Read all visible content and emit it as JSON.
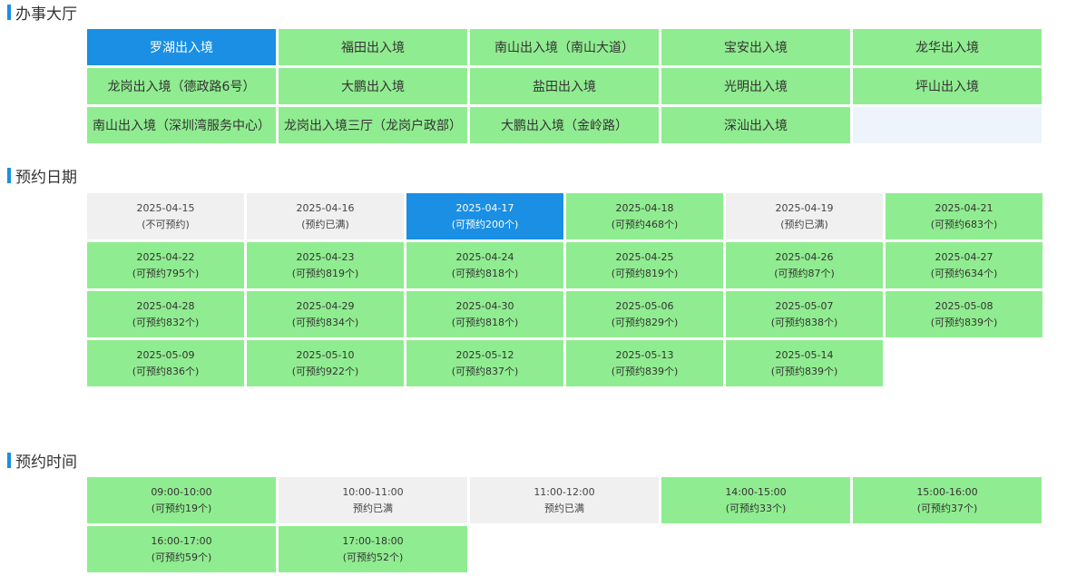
{
  "sections": {
    "hall_title": "办事大厅",
    "date_title": "预约日期",
    "time_title": "预约时间"
  },
  "halls": [
    {
      "name": "罗湖出入境",
      "state": "selected"
    },
    {
      "name": "福田出入境",
      "state": "available"
    },
    {
      "name": "南山出入境（南山大道）",
      "state": "available"
    },
    {
      "name": "宝安出入境",
      "state": "available"
    },
    {
      "name": "龙华出入境",
      "state": "available"
    },
    {
      "name": "龙岗出入境（德政路6号）",
      "state": "available"
    },
    {
      "name": "大鹏出入境",
      "state": "available"
    },
    {
      "name": "盐田出入境",
      "state": "available"
    },
    {
      "name": "光明出入境",
      "state": "available"
    },
    {
      "name": "坪山出入境",
      "state": "available"
    },
    {
      "name": "南山出入境（深圳湾服务中心）",
      "state": "available"
    },
    {
      "name": "龙岗出入境三厅（龙岗户政部）",
      "state": "available"
    },
    {
      "name": "大鹏出入境（金岭路）",
      "state": "available"
    },
    {
      "name": "深汕出入境",
      "state": "available"
    }
  ],
  "dates": [
    {
      "date": "2025-04-15",
      "status": "(不可预约)",
      "state": "disabled"
    },
    {
      "date": "2025-04-16",
      "status": "(预约已满)",
      "state": "disabled"
    },
    {
      "date": "2025-04-17",
      "status": "(可预约200个)",
      "state": "selected"
    },
    {
      "date": "2025-04-18",
      "status": "(可预约468个)",
      "state": "available"
    },
    {
      "date": "2025-04-19",
      "status": "(预约已满)",
      "state": "disabled"
    },
    {
      "date": "2025-04-21",
      "status": "(可预约683个)",
      "state": "available"
    },
    {
      "date": "2025-04-22",
      "status": "(可预约795个)",
      "state": "available"
    },
    {
      "date": "2025-04-23",
      "status": "(可预约819个)",
      "state": "available"
    },
    {
      "date": "2025-04-24",
      "status": "(可预约818个)",
      "state": "available"
    },
    {
      "date": "2025-04-25",
      "status": "(可预约819个)",
      "state": "available"
    },
    {
      "date": "2025-04-26",
      "status": "(可预约87个)",
      "state": "available"
    },
    {
      "date": "2025-04-27",
      "status": "(可预约634个)",
      "state": "available"
    },
    {
      "date": "2025-04-28",
      "status": "(可预约832个)",
      "state": "available"
    },
    {
      "date": "2025-04-29",
      "status": "(可预约834个)",
      "state": "available"
    },
    {
      "date": "2025-04-30",
      "status": "(可预约818个)",
      "state": "available"
    },
    {
      "date": "2025-05-06",
      "status": "(可预约829个)",
      "state": "available"
    },
    {
      "date": "2025-05-07",
      "status": "(可预约838个)",
      "state": "available"
    },
    {
      "date": "2025-05-08",
      "status": "(可预约839个)",
      "state": "available"
    },
    {
      "date": "2025-05-09",
      "status": "(可预约836个)",
      "state": "available"
    },
    {
      "date": "2025-05-10",
      "status": "(可预约922个)",
      "state": "available"
    },
    {
      "date": "2025-05-12",
      "status": "(可预约837个)",
      "state": "available"
    },
    {
      "date": "2025-05-13",
      "status": "(可预约839个)",
      "state": "available"
    },
    {
      "date": "2025-05-14",
      "status": "(可预约839个)",
      "state": "available"
    }
  ],
  "times": [
    {
      "time": "09:00-10:00",
      "status": "(可预约19个)",
      "state": "available"
    },
    {
      "time": "10:00-11:00",
      "status": "预约已满",
      "state": "disabled"
    },
    {
      "time": "11:00-12:00",
      "status": "预约已满",
      "state": "disabled"
    },
    {
      "time": "14:00-15:00",
      "status": "(可预约33个)",
      "state": "available"
    },
    {
      "time": "15:00-16:00",
      "status": "(可预约37个)",
      "state": "available"
    },
    {
      "time": "16:00-17:00",
      "status": "(可预约59个)",
      "state": "available"
    },
    {
      "time": "17:00-18:00",
      "status": "(可预约52个)",
      "state": "available"
    }
  ],
  "colors": {
    "available": "#90ec90",
    "selected": "#1a8fe3",
    "disabled": "#f0f0f0",
    "accent_bar": "#1a8fe3"
  }
}
